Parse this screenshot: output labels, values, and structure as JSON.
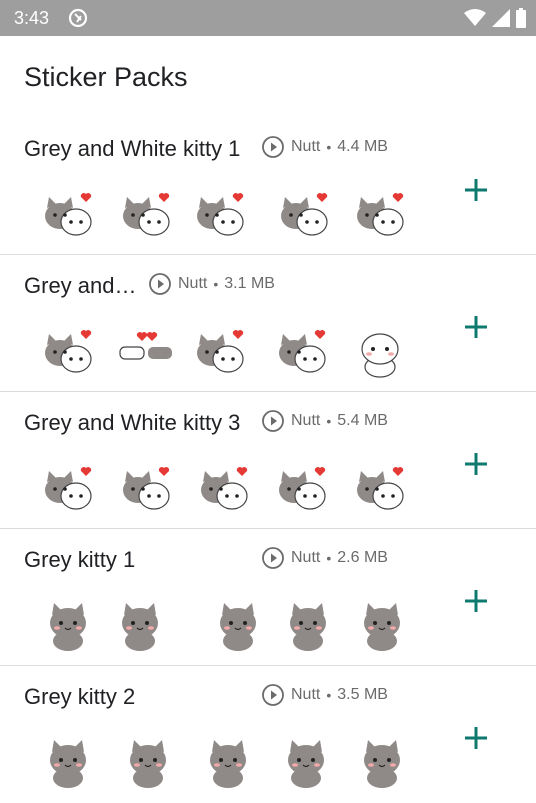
{
  "status_bar": {
    "time": "3:43"
  },
  "title": "Sticker Packs",
  "colors": {
    "accent": "#0e7a6d",
    "status_bar": "#9e9e9e",
    "meta_text": "#6b6b6b",
    "divider": "#dcdcdc"
  },
  "packs": [
    {
      "name": "Grey and White kitty 1",
      "author": "Nutt",
      "size": "4.4 MB",
      "animated": true
    },
    {
      "name": "Grey and…",
      "author": "Nutt",
      "size": "3.1 MB",
      "animated": true
    },
    {
      "name": "Grey and White kitty 3",
      "author": "Nutt",
      "size": "5.4 MB",
      "animated": true
    },
    {
      "name": "Grey kitty 1",
      "author": "Nutt",
      "size": "2.6 MB",
      "animated": true
    },
    {
      "name": "Grey kitty 2",
      "author": "Nutt",
      "size": "3.5 MB",
      "animated": true
    }
  ],
  "icons": {
    "status": [
      "notification-icon",
      "wifi-icon",
      "signal-icon",
      "battery-icon"
    ],
    "pack": [
      "play-icon",
      "add-icon"
    ]
  }
}
